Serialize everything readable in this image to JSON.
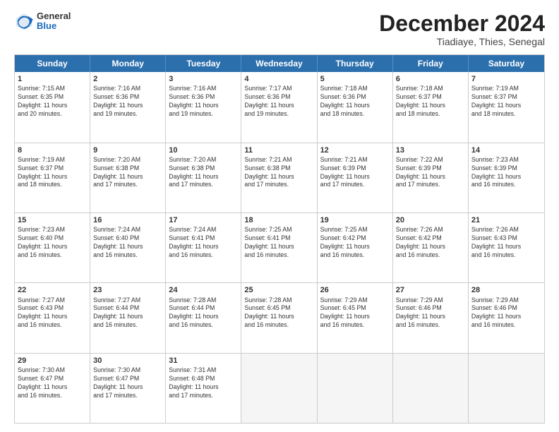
{
  "header": {
    "logo_general": "General",
    "logo_blue": "Blue",
    "title": "December 2024",
    "subtitle": "Tiadiaye, Thies, Senegal"
  },
  "calendar": {
    "weekdays": [
      "Sunday",
      "Monday",
      "Tuesday",
      "Wednesday",
      "Thursday",
      "Friday",
      "Saturday"
    ],
    "rows": [
      [
        {
          "day": "1",
          "info": "Sunrise: 7:15 AM\nSunset: 6:35 PM\nDaylight: 11 hours\nand 20 minutes."
        },
        {
          "day": "2",
          "info": "Sunrise: 7:16 AM\nSunset: 6:36 PM\nDaylight: 11 hours\nand 19 minutes."
        },
        {
          "day": "3",
          "info": "Sunrise: 7:16 AM\nSunset: 6:36 PM\nDaylight: 11 hours\nand 19 minutes."
        },
        {
          "day": "4",
          "info": "Sunrise: 7:17 AM\nSunset: 6:36 PM\nDaylight: 11 hours\nand 19 minutes."
        },
        {
          "day": "5",
          "info": "Sunrise: 7:18 AM\nSunset: 6:36 PM\nDaylight: 11 hours\nand 18 minutes."
        },
        {
          "day": "6",
          "info": "Sunrise: 7:18 AM\nSunset: 6:37 PM\nDaylight: 11 hours\nand 18 minutes."
        },
        {
          "day": "7",
          "info": "Sunrise: 7:19 AM\nSunset: 6:37 PM\nDaylight: 11 hours\nand 18 minutes."
        }
      ],
      [
        {
          "day": "8",
          "info": "Sunrise: 7:19 AM\nSunset: 6:37 PM\nDaylight: 11 hours\nand 18 minutes."
        },
        {
          "day": "9",
          "info": "Sunrise: 7:20 AM\nSunset: 6:38 PM\nDaylight: 11 hours\nand 17 minutes."
        },
        {
          "day": "10",
          "info": "Sunrise: 7:20 AM\nSunset: 6:38 PM\nDaylight: 11 hours\nand 17 minutes."
        },
        {
          "day": "11",
          "info": "Sunrise: 7:21 AM\nSunset: 6:38 PM\nDaylight: 11 hours\nand 17 minutes."
        },
        {
          "day": "12",
          "info": "Sunrise: 7:21 AM\nSunset: 6:39 PM\nDaylight: 11 hours\nand 17 minutes."
        },
        {
          "day": "13",
          "info": "Sunrise: 7:22 AM\nSunset: 6:39 PM\nDaylight: 11 hours\nand 17 minutes."
        },
        {
          "day": "14",
          "info": "Sunrise: 7:23 AM\nSunset: 6:39 PM\nDaylight: 11 hours\nand 16 minutes."
        }
      ],
      [
        {
          "day": "15",
          "info": "Sunrise: 7:23 AM\nSunset: 6:40 PM\nDaylight: 11 hours\nand 16 minutes."
        },
        {
          "day": "16",
          "info": "Sunrise: 7:24 AM\nSunset: 6:40 PM\nDaylight: 11 hours\nand 16 minutes."
        },
        {
          "day": "17",
          "info": "Sunrise: 7:24 AM\nSunset: 6:41 PM\nDaylight: 11 hours\nand 16 minutes."
        },
        {
          "day": "18",
          "info": "Sunrise: 7:25 AM\nSunset: 6:41 PM\nDaylight: 11 hours\nand 16 minutes."
        },
        {
          "day": "19",
          "info": "Sunrise: 7:25 AM\nSunset: 6:42 PM\nDaylight: 11 hours\nand 16 minutes."
        },
        {
          "day": "20",
          "info": "Sunrise: 7:26 AM\nSunset: 6:42 PM\nDaylight: 11 hours\nand 16 minutes."
        },
        {
          "day": "21",
          "info": "Sunrise: 7:26 AM\nSunset: 6:43 PM\nDaylight: 11 hours\nand 16 minutes."
        }
      ],
      [
        {
          "day": "22",
          "info": "Sunrise: 7:27 AM\nSunset: 6:43 PM\nDaylight: 11 hours\nand 16 minutes."
        },
        {
          "day": "23",
          "info": "Sunrise: 7:27 AM\nSunset: 6:44 PM\nDaylight: 11 hours\nand 16 minutes."
        },
        {
          "day": "24",
          "info": "Sunrise: 7:28 AM\nSunset: 6:44 PM\nDaylight: 11 hours\nand 16 minutes."
        },
        {
          "day": "25",
          "info": "Sunrise: 7:28 AM\nSunset: 6:45 PM\nDaylight: 11 hours\nand 16 minutes."
        },
        {
          "day": "26",
          "info": "Sunrise: 7:29 AM\nSunset: 6:45 PM\nDaylight: 11 hours\nand 16 minutes."
        },
        {
          "day": "27",
          "info": "Sunrise: 7:29 AM\nSunset: 6:46 PM\nDaylight: 11 hours\nand 16 minutes."
        },
        {
          "day": "28",
          "info": "Sunrise: 7:29 AM\nSunset: 6:46 PM\nDaylight: 11 hours\nand 16 minutes."
        }
      ],
      [
        {
          "day": "29",
          "info": "Sunrise: 7:30 AM\nSunset: 6:47 PM\nDaylight: 11 hours\nand 16 minutes."
        },
        {
          "day": "30",
          "info": "Sunrise: 7:30 AM\nSunset: 6:47 PM\nDaylight: 11 hours\nand 17 minutes."
        },
        {
          "day": "31",
          "info": "Sunrise: 7:31 AM\nSunset: 6:48 PM\nDaylight: 11 hours\nand 17 minutes."
        },
        {
          "day": "",
          "info": ""
        },
        {
          "day": "",
          "info": ""
        },
        {
          "day": "",
          "info": ""
        },
        {
          "day": "",
          "info": ""
        }
      ]
    ]
  }
}
